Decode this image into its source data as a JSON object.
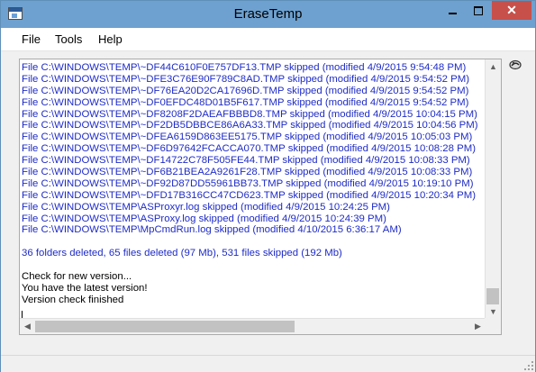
{
  "window": {
    "title": "EraseTemp"
  },
  "controls": {
    "minimize": "",
    "maximize": "",
    "close": "✕"
  },
  "menu": {
    "file": "File",
    "tools": "Tools",
    "help": "Help"
  },
  "log": {
    "lines": [
      "File C:\\WINDOWS\\TEMP\\~DF44C610F0E757DF13.TMP skipped (modified 4/9/2015 9:54:48 PM)",
      "File C:\\WINDOWS\\TEMP\\~DFE3C76E90F789C8AD.TMP skipped (modified 4/9/2015 9:54:52 PM)",
      "File C:\\WINDOWS\\TEMP\\~DF76EA20D2CA17696D.TMP skipped (modified 4/9/2015 9:54:52 PM)",
      "File C:\\WINDOWS\\TEMP\\~DF0EFDC48D01B5F617.TMP skipped (modified 4/9/2015 9:54:52 PM)",
      "File C:\\WINDOWS\\TEMP\\~DF8208F2DAEAFBBBD8.TMP skipped (modified 4/9/2015 10:04:15 PM)",
      "File C:\\WINDOWS\\TEMP\\~DF2DB5DBBCE86A6A33.TMP skipped (modified 4/9/2015 10:04:56 PM)",
      "File C:\\WINDOWS\\TEMP\\~DFEA6159D863EE5175.TMP skipped (modified 4/9/2015 10:05:03 PM)",
      "File C:\\WINDOWS\\TEMP\\~DF6D97642FCACCA070.TMP skipped (modified 4/9/2015 10:08:28 PM)",
      "File C:\\WINDOWS\\TEMP\\~DF14722C78F505FE44.TMP skipped (modified 4/9/2015 10:08:33 PM)",
      "File C:\\WINDOWS\\TEMP\\~DF6B21BEA2A9261F28.TMP skipped (modified 4/9/2015 10:08:33 PM)",
      "File C:\\WINDOWS\\TEMP\\~DF92D87DD55961BB73.TMP skipped (modified 4/9/2015 10:19:10 PM)",
      "File C:\\WINDOWS\\TEMP\\~DFD17B316CC47CD623.TMP skipped (modified 4/9/2015 10:20:34 PM)",
      "File C:\\WINDOWS\\TEMP\\ASProxyr.log skipped (modified 4/9/2015 10:24:25 PM)",
      "File C:\\WINDOWS\\TEMP\\ASProxy.log skipped (modified 4/9/2015 10:24:39 PM)",
      "File C:\\WINDOWS\\TEMP\\MpCmdRun.log skipped (modified 4/10/2015 6:36:17 AM)",
      "",
      "36 folders deleted, 65 files deleted (97 Mb), 531 files skipped (192 Mb)",
      "",
      "Check for new version...",
      "You have the latest version!",
      "Version check finished"
    ]
  },
  "colors": {
    "log_text": "#1f2cc6",
    "titlebar": "#6ea1cf",
    "close": "#c7504b"
  },
  "icons": {
    "toolbar": "clean-icon"
  }
}
